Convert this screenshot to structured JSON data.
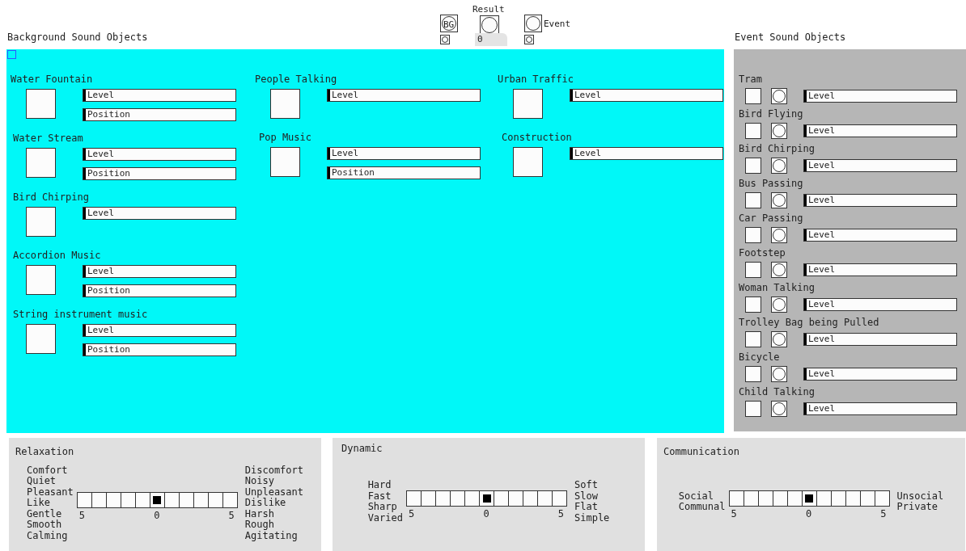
{
  "top_controls": {
    "bg_label": "BG",
    "result_label": "Result",
    "number_value": "0",
    "event_label": "Event"
  },
  "background": {
    "title": "Background Sound Objects",
    "columns": [
      {
        "items": [
          {
            "name": "Water Fountain",
            "checked": false,
            "sliders": [
              {
                "label": "Level",
                "level": 0
              },
              {
                "label": "Position",
                "level": 0
              }
            ]
          },
          {
            "name": "Water Stream",
            "checked": false,
            "sliders": [
              {
                "label": "Level",
                "level": 0
              },
              {
                "label": "Position",
                "level": 0
              }
            ]
          },
          {
            "name": "Bird Chirping",
            "checked": false,
            "sliders": [
              {
                "label": "Level",
                "level": 0
              }
            ]
          },
          {
            "name": "Accordion Music",
            "checked": false,
            "sliders": [
              {
                "label": "Level",
                "level": 0
              },
              {
                "label": "Position",
                "level": 0
              }
            ]
          },
          {
            "name": "String instrument music",
            "checked": false,
            "sliders": [
              {
                "label": "Level",
                "level": 0
              },
              {
                "label": "Position",
                "level": 0
              }
            ]
          }
        ]
      },
      {
        "items": [
          {
            "name": "People Talking",
            "checked": false,
            "sliders": [
              {
                "label": "Level",
                "level": 0
              }
            ]
          },
          {
            "name": "Pop Music",
            "checked": false,
            "sliders": [
              {
                "label": "Level",
                "level": 0
              },
              {
                "label": "Position",
                "level": 0
              }
            ]
          }
        ]
      },
      {
        "items": [
          {
            "name": "Urban Traffic",
            "checked": false,
            "sliders": [
              {
                "label": "Level",
                "level": 0
              }
            ]
          },
          {
            "name": "Construction",
            "checked": false,
            "sliders": [
              {
                "label": "Level",
                "level": 0
              }
            ]
          }
        ]
      }
    ]
  },
  "events": {
    "title": "Event Sound Objects",
    "items": [
      {
        "name": "Tram",
        "checked": false,
        "slider": {
          "label": "Level",
          "level": 0
        }
      },
      {
        "name": "Bird Flying",
        "checked": false,
        "slider": {
          "label": "Level",
          "level": 0
        }
      },
      {
        "name": "Bird Chirping",
        "checked": false,
        "slider": {
          "label": "Level",
          "level": 0
        }
      },
      {
        "name": "Bus Passing",
        "checked": false,
        "slider": {
          "label": "Level",
          "level": 0
        }
      },
      {
        "name": "Car Passing",
        "checked": false,
        "slider": {
          "label": "Level",
          "level": 0
        }
      },
      {
        "name": "Footstep",
        "checked": false,
        "slider": {
          "label": "Level",
          "level": 0
        }
      },
      {
        "name": "Woman Talking",
        "checked": false,
        "slider": {
          "label": "Level",
          "level": 0
        }
      },
      {
        "name": "Trolley Bag being Pulled",
        "checked": false,
        "slider": {
          "label": "Level",
          "level": 0
        }
      },
      {
        "name": "Bicycle",
        "checked": false,
        "slider": {
          "label": "Level",
          "level": 0
        }
      },
      {
        "name": "Child Talking",
        "checked": false,
        "slider": {
          "label": "Level",
          "level": 0
        }
      }
    ]
  },
  "scales": [
    {
      "title": "Relaxation",
      "left_words": [
        "Comfort",
        "Quiet",
        "Pleasant",
        "Like",
        "Gentle",
        "Smooth",
        "Calming"
      ],
      "right_words": [
        "Discomfort",
        "Noisy",
        "Unpleasant",
        "Dislike",
        "Harsh",
        "Rough",
        "Agitating"
      ],
      "ticks": [
        "5",
        "0",
        "5"
      ],
      "cells": [
        {
          "selected": false
        },
        {
          "selected": false
        },
        {
          "selected": false
        },
        {
          "selected": false
        },
        {
          "selected": false
        },
        {
          "selected": true
        },
        {
          "selected": false
        },
        {
          "selected": false
        },
        {
          "selected": false
        },
        {
          "selected": false
        },
        {
          "selected": false
        }
      ]
    },
    {
      "title": "Dynamic",
      "left_words": [
        "Hard",
        "Fast",
        "Sharp",
        "Varied"
      ],
      "right_words": [
        "Soft",
        "Slow",
        "Flat",
        "Simple"
      ],
      "ticks": [
        "5",
        "0",
        "5"
      ],
      "cells": [
        {
          "selected": false
        },
        {
          "selected": false
        },
        {
          "selected": false
        },
        {
          "selected": false
        },
        {
          "selected": false
        },
        {
          "selected": true
        },
        {
          "selected": false
        },
        {
          "selected": false
        },
        {
          "selected": false
        },
        {
          "selected": false
        },
        {
          "selected": false
        }
      ]
    },
    {
      "title": "Communication",
      "left_words": [
        "Social",
        "Communal"
      ],
      "right_words": [
        "Unsocial",
        "Private"
      ],
      "ticks": [
        "5",
        "0",
        "5"
      ],
      "cells": [
        {
          "selected": false
        },
        {
          "selected": false
        },
        {
          "selected": false
        },
        {
          "selected": false
        },
        {
          "selected": false
        },
        {
          "selected": true
        },
        {
          "selected": false
        },
        {
          "selected": false
        },
        {
          "selected": false
        },
        {
          "selected": false
        },
        {
          "selected": false
        }
      ]
    }
  ]
}
